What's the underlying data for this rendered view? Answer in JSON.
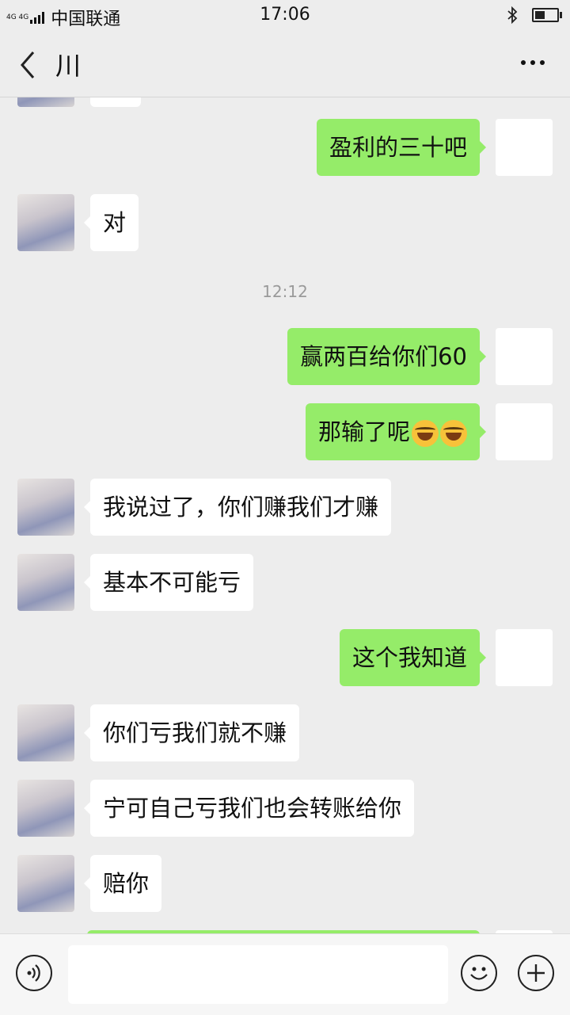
{
  "status_bar": {
    "network": "4G 4G",
    "carrier": "中国联通",
    "time": "17:06",
    "icons": [
      "signal-icon",
      "bluetooth-icon",
      "battery-icon"
    ]
  },
  "header": {
    "title": "川",
    "back_icon": "chevron-left-icon",
    "more_icon": "more-icon"
  },
  "messages": [
    {
      "side": "right",
      "text": "盈利的三十吧"
    },
    {
      "side": "left",
      "text": "对"
    },
    {
      "type": "time",
      "text": "12:12"
    },
    {
      "side": "right",
      "text": "赢两百给你们60"
    },
    {
      "side": "right",
      "text": "那输了呢",
      "emoji": "face-with-tears-of-joy"
    },
    {
      "side": "left",
      "text": "我说过了，你们赚我们才赚"
    },
    {
      "side": "left",
      "text": "基本不可能亏"
    },
    {
      "side": "right",
      "text": "这个我知道"
    },
    {
      "side": "left",
      "text": "你们亏我们就不赚"
    },
    {
      "side": "left",
      "text": "宁可自己亏我们也会转账给你"
    },
    {
      "side": "left",
      "text": "赔你"
    }
  ],
  "input_bar": {
    "icons": [
      "voice-icon",
      "emoji-icon",
      "plus-icon"
    ],
    "value": ""
  },
  "colors": {
    "sent_bubble": "#95ec69",
    "received_bubble": "#ffffff",
    "background": "#ededed"
  }
}
